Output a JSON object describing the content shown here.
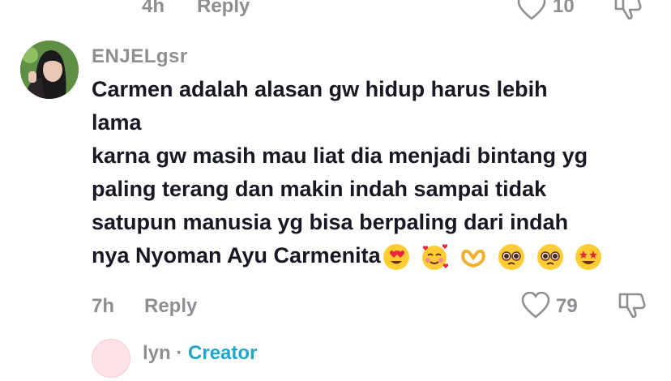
{
  "prev_comment": {
    "time": "4h",
    "reply_label": "Reply",
    "likes": "10"
  },
  "comment": {
    "username": "ENJELgsr",
    "lines": [
      "Carmen adalah alasan gw hidup harus lebih",
      "lama",
      "karna gw masih mau liat dia menjadi bintang yg",
      "paling terang dan makin indah sampai tidak",
      "satupun manusia yg bisa berpaling dari indah",
      "nya Nyoman Ayu Carmenita"
    ],
    "emojis": [
      "heart-eyes-emoji",
      "smiling-hearts-emoji",
      "heart-hands-emoji",
      "pleading-face-emoji",
      "pleading-face-emoji",
      "star-struck-emoji"
    ],
    "time": "7h",
    "reply_label": "Reply",
    "likes": "79"
  },
  "reply": {
    "username": "lyn",
    "separator": "·",
    "badge": "Creator"
  },
  "colors": {
    "accent": "#20a6c9",
    "muted": "#8e8e93",
    "text": "#161823"
  }
}
